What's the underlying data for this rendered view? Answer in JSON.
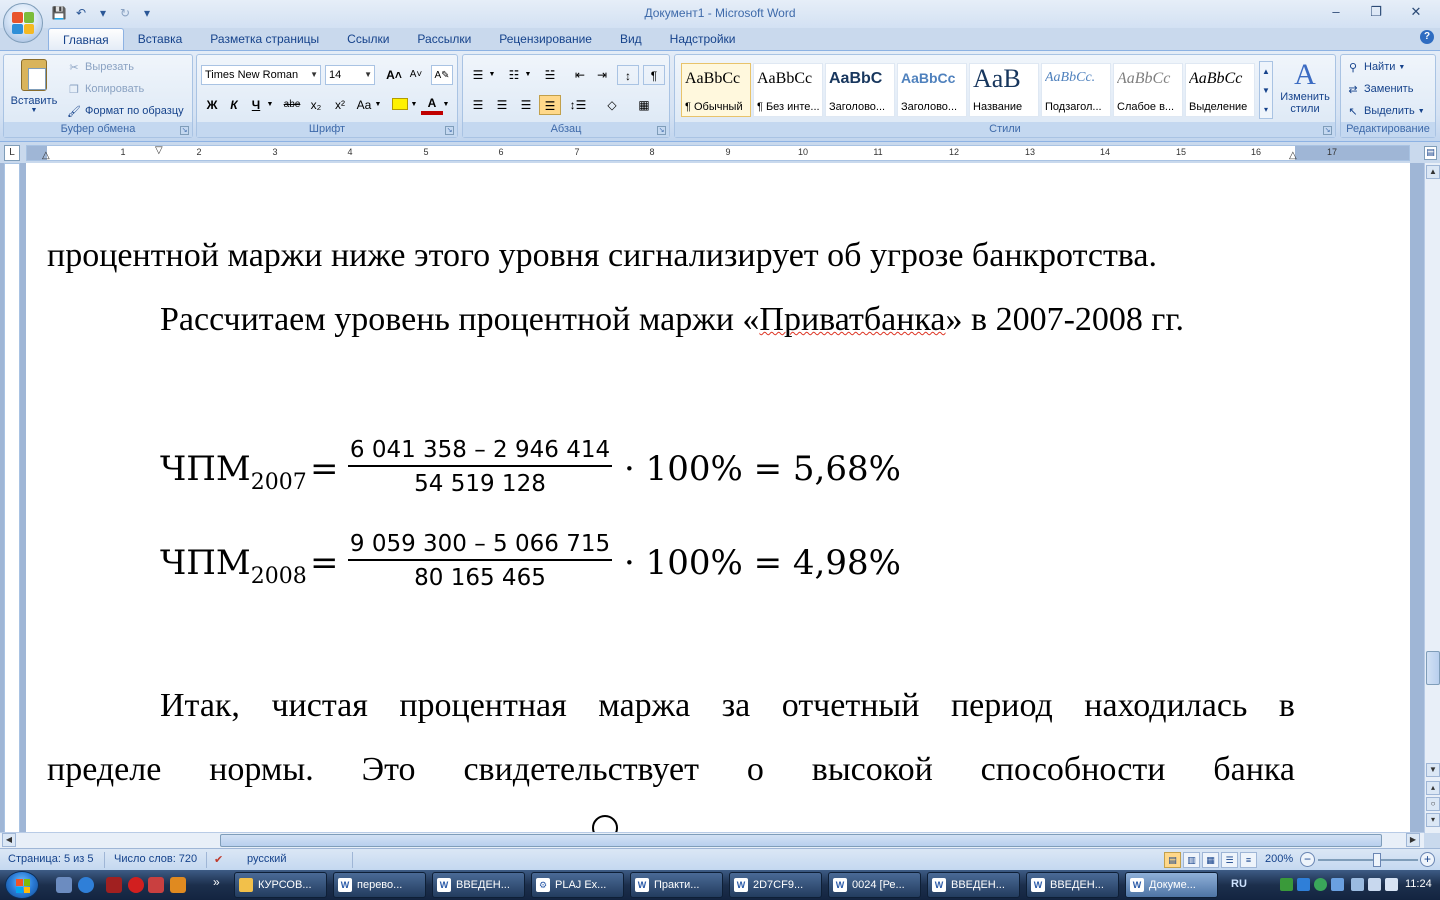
{
  "window": {
    "title": "Документ1 - Microsoft Word"
  },
  "tabs": [
    "Главная",
    "Вставка",
    "Разметка страницы",
    "Ссылки",
    "Рассылки",
    "Рецензирование",
    "Вид",
    "Надстройки"
  ],
  "ribbon": {
    "clipboard": {
      "label": "Буфер обмена",
      "paste": "Вставить",
      "cut": "Вырезать",
      "copy": "Копировать",
      "format_painter": "Формат по образцу"
    },
    "font": {
      "label": "Шрифт",
      "font_name": "Times New Roman",
      "font_size": "14",
      "bold": "Ж",
      "italic": "К",
      "underline": "Ч",
      "strikethrough": "abe",
      "subscript": "x₂",
      "superscript": "x²",
      "change_case": "Aa",
      "grow": "A",
      "shrink": "A"
    },
    "paragraph": {
      "label": "Абзац"
    },
    "styles": {
      "label": "Стили",
      "change_styles": "Изменить стили",
      "items": [
        {
          "sample": "AaBbCc",
          "name": "¶ Обычный"
        },
        {
          "sample": "AaBbCc",
          "name": "¶ Без инте..."
        },
        {
          "sample": "AaBbC",
          "name": "Заголово..."
        },
        {
          "sample": "AaBbCc",
          "name": "Заголово..."
        },
        {
          "sample": "AaB",
          "name": "Название"
        },
        {
          "sample": "AaBbCc.",
          "name": "Подзагол..."
        },
        {
          "sample": "AaBbCc",
          "name": "Слабое в..."
        },
        {
          "sample": "AaBbCc",
          "name": "Выделение"
        }
      ]
    },
    "editing": {
      "label": "Редактирование",
      "find": "Найти",
      "replace": "Заменить",
      "select": "Выделить"
    }
  },
  "ruler": {
    "numbers": [
      "1",
      "1",
      "2",
      "3",
      "4",
      "5",
      "6",
      "7",
      "8",
      "9",
      "10",
      "11",
      "12",
      "13",
      "14",
      "15",
      "16",
      "17"
    ]
  },
  "document": {
    "line1": "процентной маржи ниже этого уровня сигнализирует об угрозе банкротства.",
    "line2_prefix": "Рассчитаем уровень процентной маржи «",
    "line2_spell": "Приватбанка",
    "line2_suffix": "» в 2007-2008 гг.",
    "formulas": [
      {
        "lhs": "ЧПМ",
        "sub": "2007",
        "num": "6 041 358 – 2 946 414",
        "den": "54 519 128",
        "rhs": "· 100% = 5,68%"
      },
      {
        "lhs": "ЧПМ",
        "sub": "2008",
        "num": "9 059 300 – 5 066 715",
        "den": "80 165 465",
        "rhs": "· 100% = 4,98%"
      }
    ],
    "conclusion_line1": "Итак, чистая процентная маржа за отчетный период находилась в",
    "conclusion_line2": "пределе нормы. Это свидетельствует о высокой способности банка"
  },
  "status": {
    "page": "Страница: 5 из 5",
    "words": "Число слов: 720",
    "language": "русский",
    "zoom": "200%",
    "zoom_level_percent": 200
  },
  "taskbar": {
    "buttons": [
      {
        "label": "КУРСОВ...",
        "icon": "folder-icon"
      },
      {
        "label": "перево...",
        "icon": "word-icon"
      },
      {
        "label": "ВВЕДЕН...",
        "icon": "word-icon"
      },
      {
        "label": "PLAJ Ex...",
        "icon": "app-icon"
      },
      {
        "label": "Практи...",
        "icon": "word-icon"
      },
      {
        "label": "2D7CF9...",
        "icon": "word-icon"
      },
      {
        "label": "0024 [Ре...",
        "icon": "word-icon"
      },
      {
        "label": "ВВЕДЕН...",
        "icon": "word-icon"
      },
      {
        "label": "ВВЕДЕН...",
        "icon": "word-icon"
      },
      {
        "label": "Докуме...",
        "icon": "word-icon"
      }
    ],
    "language": "RU",
    "time": "11:24"
  },
  "colors": {
    "ribbon_text": "#15428b",
    "spell_underline": "#dd3322",
    "taskbar": "#1c2f4c"
  }
}
